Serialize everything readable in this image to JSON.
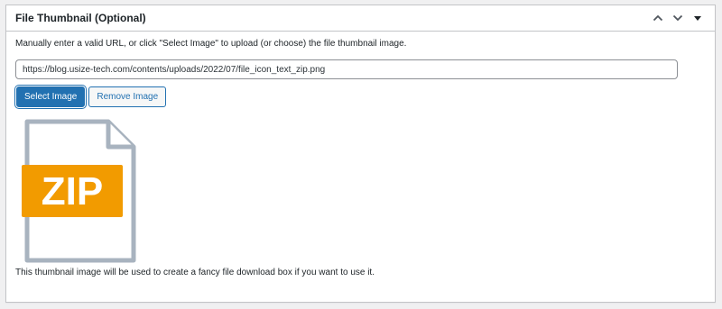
{
  "metabox": {
    "title": "File Thumbnail (Optional)",
    "move_up_icon": "chevron-up-icon",
    "move_down_icon": "chevron-down-icon",
    "toggle_icon": "caret-down-icon"
  },
  "instructions": "Manually enter a valid URL, or click \"Select Image\" to upload (or choose) the file thumbnail image.",
  "url_field": {
    "value": "https://blog.usize-tech.com/contents/uploads/2022/07/file_icon_text_zip.png"
  },
  "buttons": {
    "select_label": "Select Image",
    "remove_label": "Remove Image"
  },
  "thumbnail": {
    "icon": "zip-file-icon",
    "label": "ZIP",
    "accent_color": "#f29b00",
    "outline_color": "#a8b3bf"
  },
  "note": "This thumbnail image will be used to create a fancy file download box if you want to use it.",
  "colors": {
    "primary": "#2271b1",
    "border": "#c3c4c7",
    "text": "#1d2327"
  }
}
